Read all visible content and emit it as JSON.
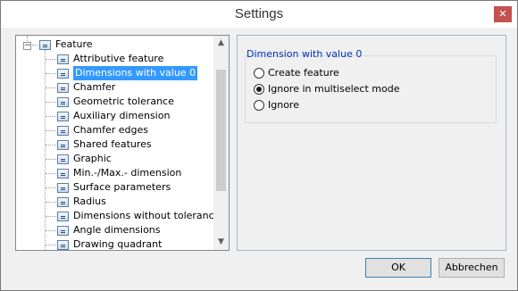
{
  "window": {
    "title": "Settings",
    "close_glyph": "✕"
  },
  "tree": {
    "root": {
      "label": "Feature",
      "expander": "−"
    },
    "items": [
      {
        "label": "Attributive feature"
      },
      {
        "label": "Dimensions with value 0",
        "selected": true
      },
      {
        "label": "Chamfer"
      },
      {
        "label": "Geometric tolerance"
      },
      {
        "label": "Auxiliary dimension"
      },
      {
        "label": "Chamfer edges"
      },
      {
        "label": "Shared features"
      },
      {
        "label": "Graphic"
      },
      {
        "label": "Min.-/Max.- dimension"
      },
      {
        "label": "Surface parameters"
      },
      {
        "label": "Radius"
      },
      {
        "label": "Dimensions without tolerance"
      },
      {
        "label": "Angle dimensions"
      },
      {
        "label": "Drawing quadrant"
      }
    ],
    "scroll_up": "▲",
    "scroll_down": "▼"
  },
  "group": {
    "title": "Dimension with value 0",
    "options": [
      {
        "label": "Create feature",
        "checked": false
      },
      {
        "label": "Ignore in multiselect mode",
        "checked": true
      },
      {
        "label": "Ignore",
        "checked": false
      }
    ]
  },
  "buttons": {
    "ok": "OK",
    "cancel": "Abbrechen"
  }
}
